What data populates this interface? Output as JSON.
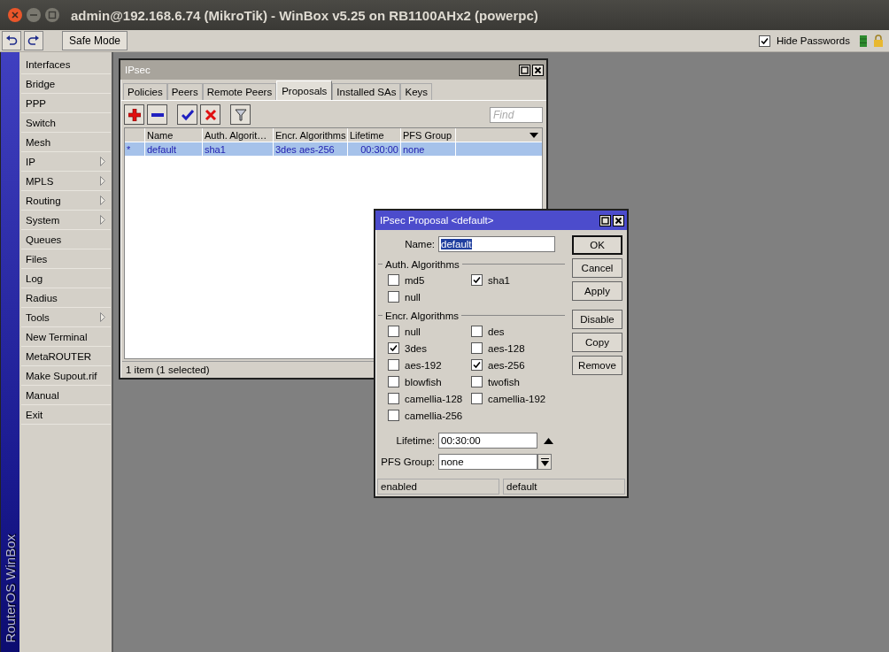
{
  "window": {
    "title": "admin@192.168.6.74 (MikroTik) - WinBox v5.25 on RB1100AHx2 (powerpc)"
  },
  "toolbar": {
    "safe_mode": "Safe Mode",
    "hide_passwords": {
      "label": "Hide Passwords",
      "checked": true
    }
  },
  "sidebar": {
    "brand": "RouterOS WinBox",
    "items": [
      {
        "label": "Interfaces",
        "submenu": false
      },
      {
        "label": "Bridge",
        "submenu": false
      },
      {
        "label": "PPP",
        "submenu": false
      },
      {
        "label": "Switch",
        "submenu": false
      },
      {
        "label": "Mesh",
        "submenu": false
      },
      {
        "label": "IP",
        "submenu": true
      },
      {
        "label": "MPLS",
        "submenu": true
      },
      {
        "label": "Routing",
        "submenu": true
      },
      {
        "label": "System",
        "submenu": true
      },
      {
        "label": "Queues",
        "submenu": false
      },
      {
        "label": "Files",
        "submenu": false
      },
      {
        "label": "Log",
        "submenu": false
      },
      {
        "label": "Radius",
        "submenu": false
      },
      {
        "label": "Tools",
        "submenu": true
      },
      {
        "label": "New Terminal",
        "submenu": false
      },
      {
        "label": "MetaROUTER",
        "submenu": false
      },
      {
        "label": "Make Supout.rif",
        "submenu": false
      },
      {
        "label": "Manual",
        "submenu": false
      },
      {
        "label": "Exit",
        "submenu": false
      }
    ]
  },
  "ipsec_window": {
    "title": "IPsec",
    "tabs": [
      {
        "label": "Policies",
        "selected": false
      },
      {
        "label": "Peers",
        "selected": false
      },
      {
        "label": "Remote Peers",
        "selected": false
      },
      {
        "label": "Proposals",
        "selected": true
      },
      {
        "label": "Installed SAs",
        "selected": false
      },
      {
        "label": "Keys",
        "selected": false
      }
    ],
    "find": {
      "placeholder": "Find"
    },
    "table": {
      "columns": [
        "Name",
        "Auth. Algorit…",
        "Encr. Algorithms",
        "Lifetime",
        "PFS Group"
      ],
      "rows": [
        {
          "flag": "*",
          "cells": [
            "default",
            "sha1",
            "3des aes-256",
            "00:30:00",
            "none"
          ],
          "selected": true
        }
      ]
    },
    "status": "1 item (1 selected)"
  },
  "proposal_dialog": {
    "title": "IPsec Proposal <default>",
    "name_label": "Name:",
    "name_value": "default",
    "auth_group": "Auth. Algorithms",
    "auth": [
      {
        "label": "md5",
        "checked": false
      },
      {
        "label": "sha1",
        "checked": true
      },
      {
        "label": "null",
        "checked": false
      }
    ],
    "encr_group": "Encr. Algorithms",
    "encr": [
      {
        "label": "null",
        "checked": false
      },
      {
        "label": "des",
        "checked": false
      },
      {
        "label": "3des",
        "checked": true
      },
      {
        "label": "aes-128",
        "checked": false
      },
      {
        "label": "aes-192",
        "checked": false
      },
      {
        "label": "aes-256",
        "checked": true
      },
      {
        "label": "blowfish",
        "checked": false
      },
      {
        "label": "twofish",
        "checked": false
      },
      {
        "label": "camellia-128",
        "checked": false
      },
      {
        "label": "camellia-192",
        "checked": false
      },
      {
        "label": "camellia-256",
        "checked": false
      }
    ],
    "lifetime_label": "Lifetime:",
    "lifetime": "00:30:00",
    "pfs_label": "PFS Group:",
    "pfs": "none",
    "buttons": [
      "OK",
      "Cancel",
      "Apply",
      "Disable",
      "Copy",
      "Remove"
    ],
    "status": [
      "enabled",
      "default"
    ]
  }
}
